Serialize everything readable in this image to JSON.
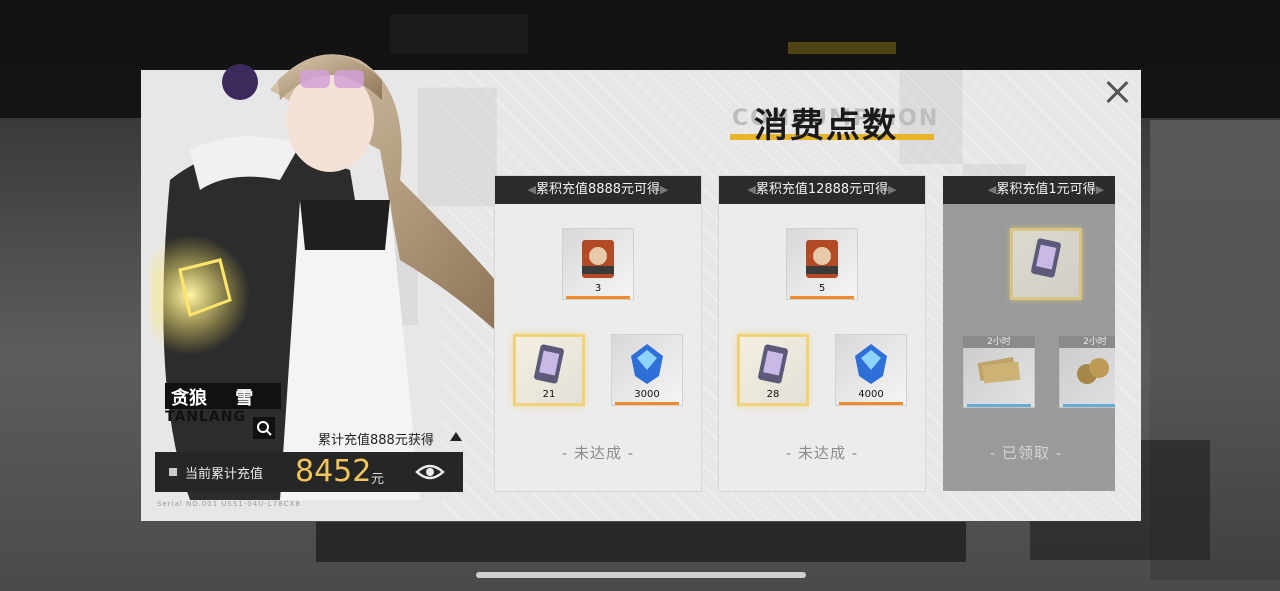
{
  "title": {
    "cn": "消费点数",
    "en": "CONSUMPTION"
  },
  "character": {
    "name_cn": "贪狼",
    "name_en": "TANLANG",
    "brand_mark": "雪"
  },
  "accumulated": {
    "reward_label": "累计充值888元获得",
    "current_label": "当前累计充值",
    "current_value": "8452",
    "unit": "元"
  },
  "serial": "Serial NO.001    USS1-04U-L78CX8",
  "cards": [
    {
      "header": "累积充值8888元可得",
      "status": "- 未达成 -",
      "claimed": false,
      "items": [
        {
          "icon": "portrait-card-icon",
          "count": "3"
        },
        {
          "icon": "ticket-icon",
          "count": "21"
        },
        {
          "icon": "crystal-icon",
          "count": "3000"
        }
      ]
    },
    {
      "header": "累积充值12888元可得",
      "status": "- 未达成 -",
      "claimed": false,
      "items": [
        {
          "icon": "portrait-card-icon",
          "count": "5"
        },
        {
          "icon": "ticket-icon",
          "count": "28"
        },
        {
          "icon": "crystal-icon",
          "count": "4000"
        }
      ]
    },
    {
      "header": "累积充值1元可得",
      "status": "- 已领取 -",
      "claimed": true,
      "items": [
        {
          "icon": "ticket-icon",
          "count": ""
        },
        {
          "icon": "bills-icon",
          "tag": "2小时",
          "count": ""
        },
        {
          "icon": "coins-icon",
          "tag": "2小时",
          "count": ""
        }
      ]
    }
  ],
  "colors": {
    "accent_gold": "#e9b528",
    "value_gold": "#f1c55c",
    "bar_orange": "#f08a2c",
    "bar_blue": "#5ab1e0",
    "header_dark": "#2b2b2b"
  }
}
